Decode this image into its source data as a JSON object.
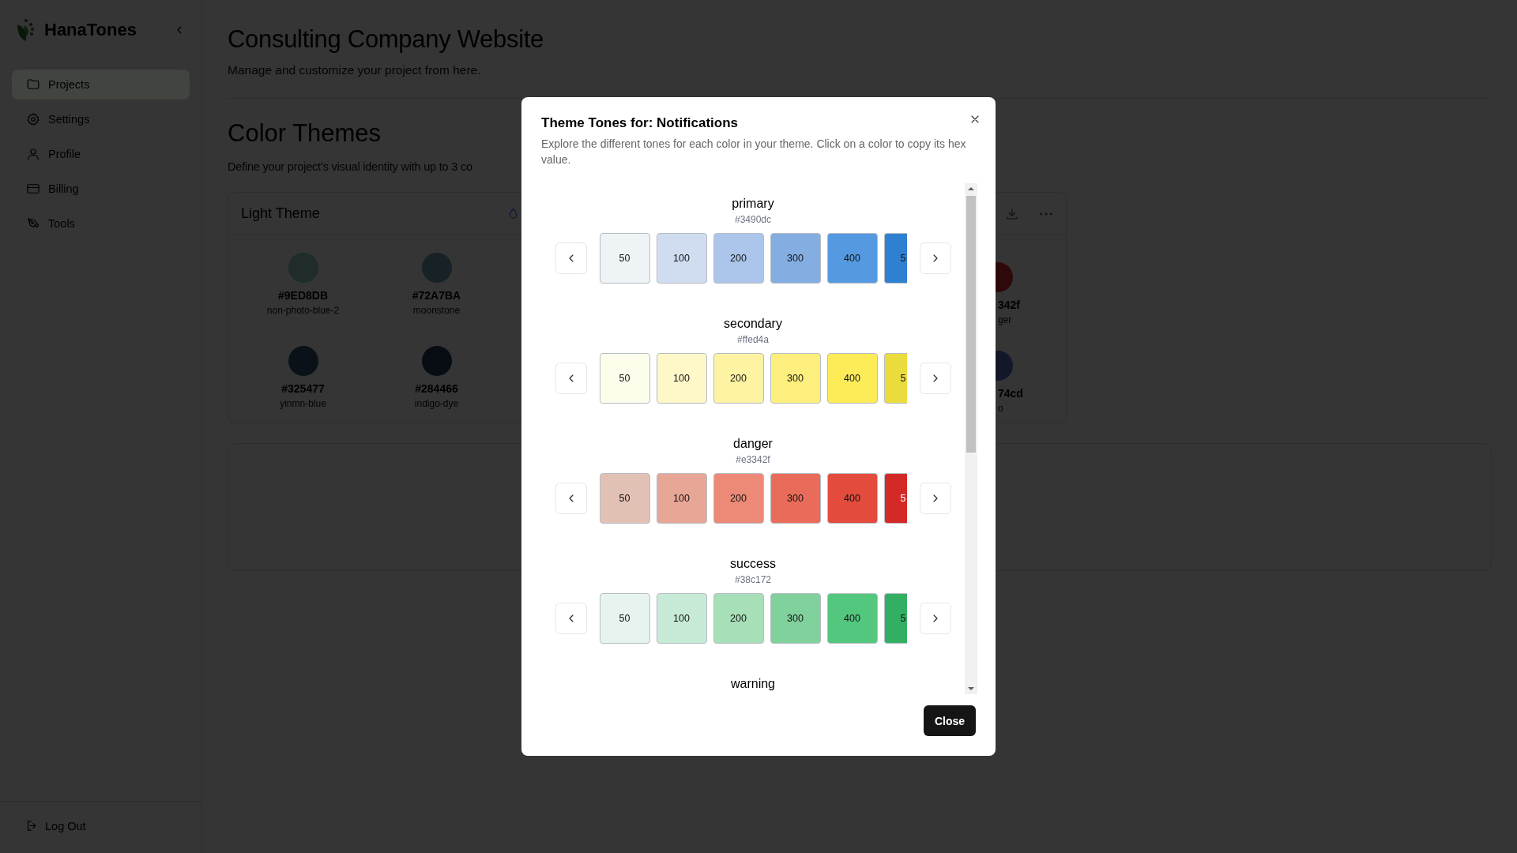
{
  "sidebar": {
    "brand": "HanaTones",
    "items": [
      {
        "label": "Projects",
        "selected": true
      },
      {
        "label": "Settings",
        "selected": false
      },
      {
        "label": "Profile",
        "selected": false
      },
      {
        "label": "Billing",
        "selected": false
      },
      {
        "label": "Tools",
        "selected": false
      }
    ],
    "logout": "Log Out"
  },
  "page": {
    "title": "Consulting Company Website",
    "subtitle": "Manage and customize your project from here."
  },
  "section": {
    "title": "Color Themes",
    "description": "Define your project’s visual identity with up to 3 co"
  },
  "theme_card": {
    "title": "Light Theme",
    "swatches": [
      {
        "hex": "#9ED8DB",
        "name": "non-photo-blue-2",
        "color": "#202b2c"
      },
      {
        "hex": "#72A7BA",
        "name": "moonstone",
        "color": "#172226"
      },
      {
        "hex": "#325477",
        "name": "yinmn-blue",
        "color": "#0a1118"
      },
      {
        "hex": "#284466",
        "name": "indigo-dye",
        "color": "#080d14"
      }
    ],
    "partial_swatches": [
      {
        "hex": "342f",
        "name": "ger",
        "color": "#2d0a09"
      },
      {
        "hex": "74cd",
        "name": "o",
        "color": "#141729"
      }
    ]
  },
  "modal": {
    "title": "Theme Tones for: Notifications",
    "description": "Explore the different tones for each color in your theme. Click on a color to copy its hex value.",
    "groups": [
      {
        "name": "primary",
        "hex": "#3490dc",
        "tones": [
          {
            "label": "50",
            "color": "#eef3f5"
          },
          {
            "label": "100",
            "color": "#d0ddf0"
          },
          {
            "label": "200",
            "color": "#abc6ea"
          },
          {
            "label": "300",
            "color": "#84aee2"
          },
          {
            "label": "400",
            "color": "#559ae0"
          },
          {
            "label": "5",
            "color": "#2f80d0"
          }
        ]
      },
      {
        "name": "secondary",
        "hex": "#ffed4a",
        "tones": [
          {
            "label": "50",
            "color": "#fdfdec"
          },
          {
            "label": "100",
            "color": "#fef7c8"
          },
          {
            "label": "200",
            "color": "#fdf3a3"
          },
          {
            "label": "300",
            "color": "#fdef7d"
          },
          {
            "label": "400",
            "color": "#fdec58"
          },
          {
            "label": "5",
            "color": "#ebdc3e"
          }
        ]
      },
      {
        "name": "danger",
        "hex": "#e3342f",
        "tones": [
          {
            "label": "50",
            "color": "#e2c1b5"
          },
          {
            "label": "100",
            "color": "#e8a697"
          },
          {
            "label": "200",
            "color": "#ec8a77"
          },
          {
            "label": "300",
            "color": "#e96c5a"
          },
          {
            "label": "400",
            "color": "#e34b3d"
          },
          {
            "label": "5",
            "color": "#d42a27"
          }
        ]
      },
      {
        "name": "success",
        "hex": "#38c172",
        "tones": [
          {
            "label": "50",
            "color": "#e6f3ee"
          },
          {
            "label": "100",
            "color": "#c7ead6"
          },
          {
            "label": "200",
            "color": "#a7dfb8"
          },
          {
            "label": "300",
            "color": "#80d19c"
          },
          {
            "label": "400",
            "color": "#54c77f"
          },
          {
            "label": "5",
            "color": "#33af63"
          }
        ]
      },
      {
        "name": "warning"
      }
    ],
    "close_button": "Close"
  }
}
